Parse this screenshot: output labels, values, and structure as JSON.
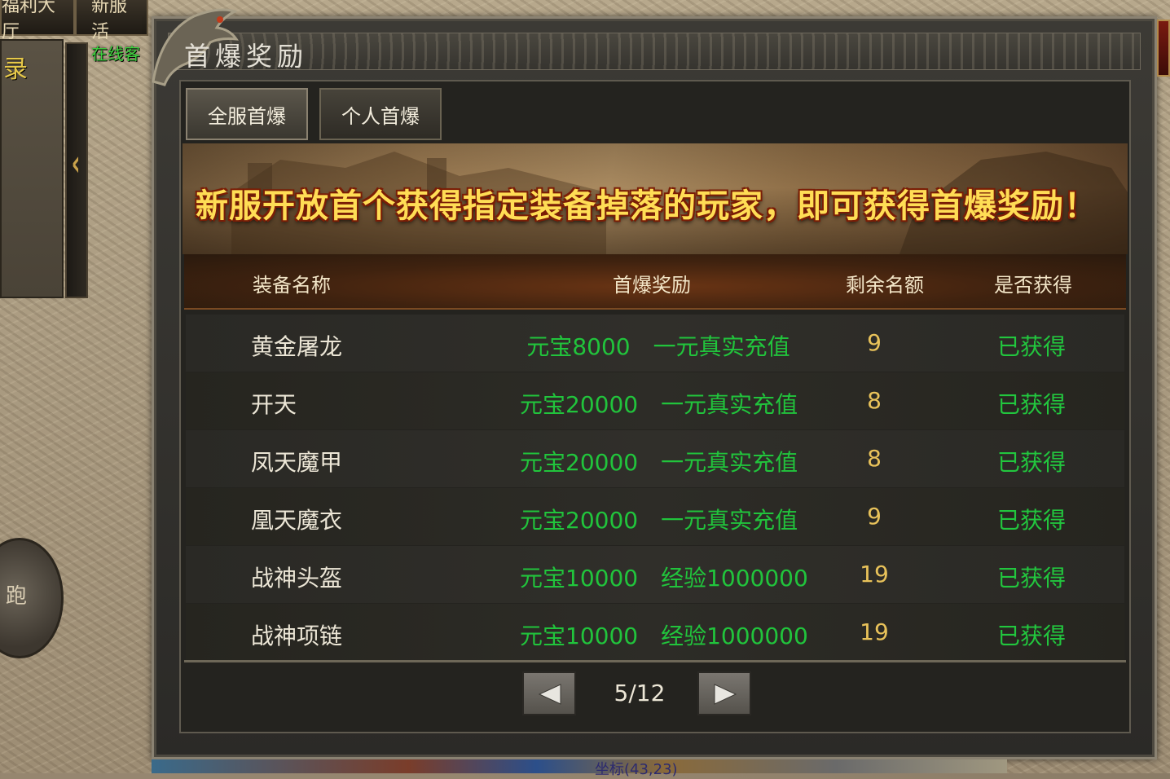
{
  "background": {
    "top_tabs": [
      "福利大厅",
      "新服活"
    ],
    "online_label": "在线客",
    "left_label": "录",
    "round_button_label": "跑",
    "coord_fragment": "坐标(43,23)"
  },
  "window": {
    "title": "首爆奖励",
    "tabs": [
      {
        "label": "全服首爆",
        "active": true
      },
      {
        "label": "个人首爆",
        "active": false
      }
    ],
    "banner_text": "新服开放首个获得指定装备掉落的玩家，即可获得首爆奖励！"
  },
  "table": {
    "headers": {
      "name": "装备名称",
      "reward": "首爆奖励",
      "remaining": "剩余名额",
      "obtained": "是否获得"
    },
    "rows": [
      {
        "name": "黄金屠龙",
        "reward": "元宝8000　一元真实充值",
        "remaining": "9",
        "obtained": "已获得"
      },
      {
        "name": "开天",
        "reward": "元宝20000　一元真实充值",
        "remaining": "8",
        "obtained": "已获得"
      },
      {
        "name": "凤天魔甲",
        "reward": "元宝20000　一元真实充值",
        "remaining": "8",
        "obtained": "已获得"
      },
      {
        "name": "凰天魔衣",
        "reward": "元宝20000　一元真实充值",
        "remaining": "9",
        "obtained": "已获得"
      },
      {
        "name": "战神头盔",
        "reward": "元宝10000　经验1000000",
        "remaining": "19",
        "obtained": "已获得"
      },
      {
        "name": "战神项链",
        "reward": "元宝10000　经验1000000",
        "remaining": "19",
        "obtained": "已获得"
      }
    ]
  },
  "pager": {
    "text": "5/12",
    "prev_icon": "triangle-left-icon",
    "next_icon": "triangle-right-icon"
  },
  "colors": {
    "reward_green": "#21c43c",
    "remaining_gold": "#e8c25a",
    "banner_yellow": "#ffdd55"
  }
}
